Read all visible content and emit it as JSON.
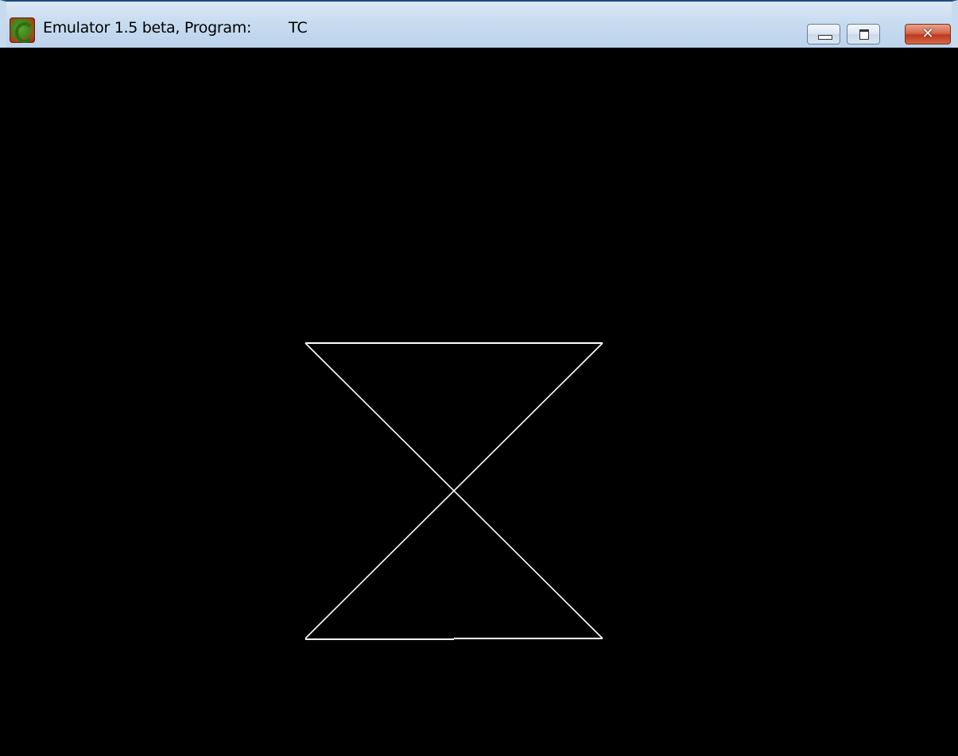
{
  "window": {
    "title": "Emulator 1.5 beta, Program:",
    "program_name": "TC"
  },
  "title_controls": {
    "minimize": "minimize-icon",
    "maximize": "maximize-icon",
    "close": "close-icon"
  },
  "colors": {
    "canvas_background": "#000000",
    "stroke": "#ffffff",
    "titlebar": "#c8dcf0",
    "close_button": "#c0391b"
  }
}
